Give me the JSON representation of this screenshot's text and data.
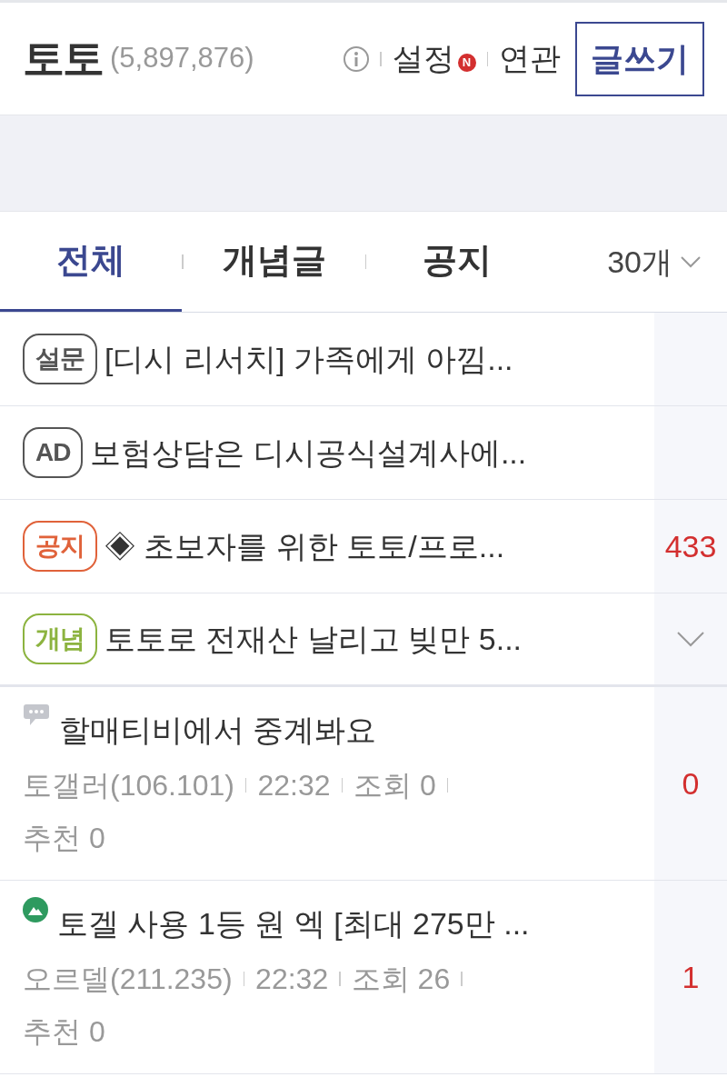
{
  "header": {
    "gallery_name": "토토",
    "member_count": "(5,897,876)",
    "settings_label": "설정",
    "settings_badge": "N",
    "related_label": "연관",
    "write_button": "글쓰기"
  },
  "tabs": [
    {
      "label": "전체",
      "selected": true
    },
    {
      "label": "개념글",
      "selected": false
    },
    {
      "label": "공지",
      "selected": false
    }
  ],
  "page_size": "30개",
  "notices": [
    {
      "badge": "설문",
      "color": "#555555",
      "title": "[디시 리서치] 가족에게 아낌...",
      "expandable": false
    },
    {
      "badge": "AD",
      "color": "#555555",
      "title": "보험상담은 디시공식설계사에...",
      "expandable": false
    },
    {
      "badge": "공지",
      "color": "#e0623a",
      "title": "◈ 초보자를 위한 토토/프로...",
      "count": "433",
      "expandable": false
    },
    {
      "badge": "개념",
      "color": "#8cb33f",
      "title": "토토로 전재산 날리고 빚만 5...",
      "expandable": true
    }
  ],
  "posts": [
    {
      "kind": "comment",
      "title": "할매티비에서 중계봐요",
      "author": "토갤러(106.101)",
      "time": "22:32",
      "views": "조회 0",
      "recommend": "추천 0",
      "count": "0"
    },
    {
      "kind": "image",
      "title": "토겔 사용 1등 원 엑 [최대 275만 ...",
      "author": "오르델(211.235)",
      "time": "22:32",
      "views": "조회 26",
      "recommend": "추천 0",
      "count": "1"
    }
  ]
}
